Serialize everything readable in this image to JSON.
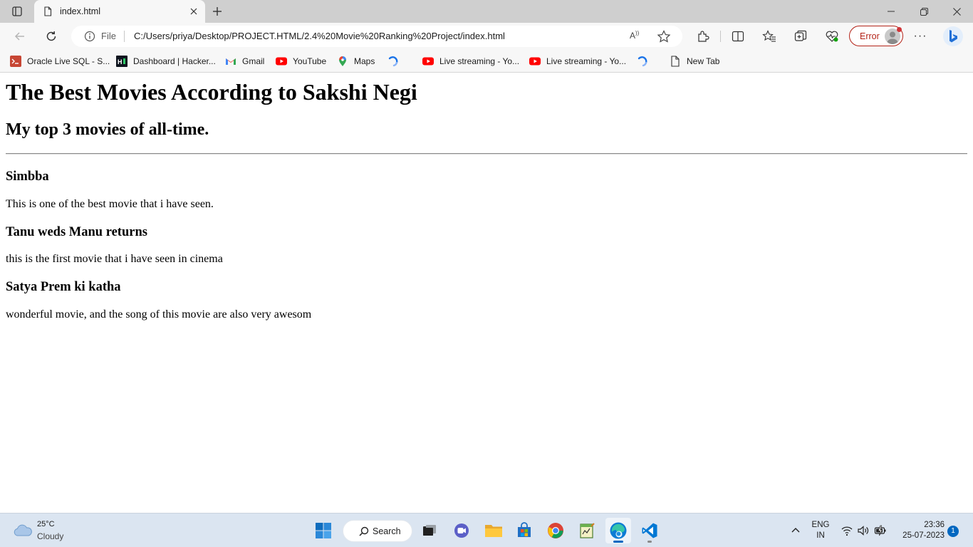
{
  "browser": {
    "tab": {
      "title": "index.html"
    },
    "address": {
      "scheme_label": "File",
      "url": "C:/Users/priya/Desktop/PROJECT.HTML/2.4%20Movie%20Ranking%20Project/index.html"
    },
    "profile": {
      "status_label": "Error"
    },
    "bookmarks": [
      {
        "label": "Oracle Live SQL - S...",
        "icon": "oracle-sql-icon"
      },
      {
        "label": "Dashboard | Hacker...",
        "icon": "hackerrank-icon"
      },
      {
        "label": "Gmail",
        "icon": "gmail-icon"
      },
      {
        "label": "YouTube",
        "icon": "youtube-icon"
      },
      {
        "label": "Maps",
        "icon": "maps-pin-icon"
      },
      {
        "label": "",
        "icon": "loading-spinner-icon"
      },
      {
        "label": "Live streaming - Yo...",
        "icon": "youtube-icon"
      },
      {
        "label": "Live streaming - Yo...",
        "icon": "youtube-icon"
      },
      {
        "label": "",
        "icon": "loading-spinner-icon"
      },
      {
        "label": "New Tab",
        "icon": "page-icon"
      }
    ]
  },
  "page": {
    "title": "The Best Movies According to Sakshi Negi",
    "subtitle": "My top 3 movies of all-time.",
    "movies": [
      {
        "name": "Simbba",
        "description": "This is one of the best movie that i have seen."
      },
      {
        "name": "Tanu weds Manu returns",
        "description": "this is the first movie that i have seen in cinema"
      },
      {
        "name": "Satya Prem ki katha",
        "description": "wonderful movie, and the song of this movie are also very awesom"
      }
    ]
  },
  "taskbar": {
    "weather": {
      "temperature": "25°C",
      "condition": "Cloudy"
    },
    "search_label": "Search",
    "apps": [
      "start-icon",
      "task-view-icon",
      "chat-icon",
      "file-explorer-icon",
      "store-icon",
      "chrome-icon",
      "notepad-icon",
      "edge-icon",
      "vscode-icon"
    ],
    "language": {
      "line1": "ENG",
      "line2": "IN"
    },
    "clock": {
      "time": "23:36",
      "date": "25-07-2023"
    },
    "notification_count": "1"
  },
  "colors": {
    "tabstrip": "#cfcfcf",
    "toolbar": "#f7f7f7",
    "error_red": "#b42318",
    "taskbar": "#dbe5f1",
    "accent_blue": "#0067c0"
  }
}
